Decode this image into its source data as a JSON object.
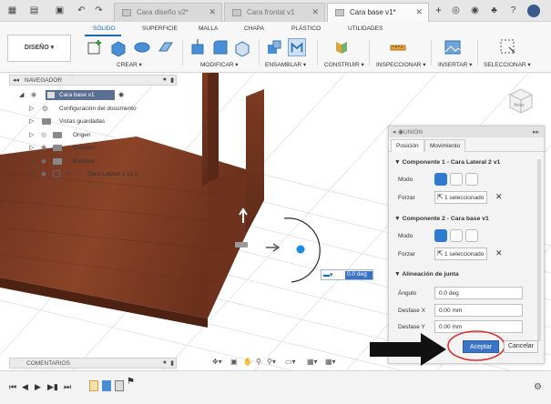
{
  "tabs": [
    {
      "label": "Cara diseño v2*",
      "active": false
    },
    {
      "label": "Cara frontal v1",
      "active": false
    },
    {
      "label": "Cara base v1*",
      "active": true
    }
  ],
  "workspace": {
    "label": "DISEÑO ▾"
  },
  "ribbon_tabs": [
    "SÓLIDO",
    "SUPERFICIE",
    "MALLA",
    "CHAPA",
    "PLÁSTICO",
    "UTILIDADES"
  ],
  "ribbon_groups": [
    "CREAR ▾",
    "MODIFICAR ▾",
    "ENSAMBLAR ▾",
    "CONSTRUIR ▾",
    "INSPECCIONAR ▾",
    "INSERTAR ▾",
    "SELECCIONAR ▾"
  ],
  "browser": {
    "title": "NAVEGADOR",
    "root": "Cara base v1",
    "items": [
      "Configuración del documento",
      "Vistas guardadas",
      "Origen",
      "Cuerpos",
      "Bocetos",
      "Cara Lateral 2 v1:1"
    ]
  },
  "union_panel": {
    "title": "UNIÓN",
    "tabs": [
      "Posición",
      "Movimiento"
    ],
    "comp1": {
      "header": "Componente 1 - Cara Lateral 2 v1",
      "mode_label": "Modo",
      "force_label": "Forzar",
      "selection": "1 seleccionado"
    },
    "comp2": {
      "header": "Componente 2 - Cara base v1",
      "mode_label": "Modo",
      "force_label": "Forzar",
      "selection": "1 seleccionado"
    },
    "alignment": {
      "header": "Alineación de junta",
      "fields": [
        {
          "label": "Ángulo",
          "value": "0.0 deg"
        },
        {
          "label": "Desfase X",
          "value": "0.00 mm"
        },
        {
          "label": "Desfase Y",
          "value": "0.00 mm"
        }
      ]
    },
    "accept": "Aceptar",
    "cancel": "Cancelar"
  },
  "viewport": {
    "angle_input": "0.0 deg",
    "viewcube_label": "Atrás"
  },
  "comments": {
    "label": "COMENTARIOS"
  },
  "colors": {
    "accent": "#1a66b7",
    "wood": "#7a3b22",
    "accept": "#3b74c4",
    "annotation": "#d63030"
  }
}
